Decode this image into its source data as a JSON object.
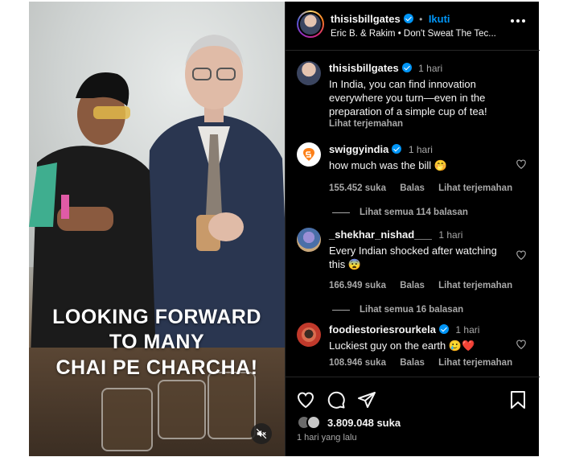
{
  "post": {
    "author": "thisisbillgates",
    "follow_label": "Ikuti",
    "separator": "•",
    "audio": "Eric B. & Rakim • Don't Sweat The Tec...",
    "more_icon": "more-horizontal-icon"
  },
  "media": {
    "overlay_lines": [
      "LOOKING FORWARD",
      "TO MANY",
      "CHAI PE CHARCHA!"
    ],
    "mute_icon": "mute-icon"
  },
  "caption": {
    "author": "thisisbillgates",
    "time": "1 hari",
    "text": "In India, you can find innovation everywhere you turn—even in the preparation of a simple cup of tea!",
    "translate": "Lihat terjemahan"
  },
  "comments": [
    {
      "user": "swiggyindia",
      "verified": true,
      "time": "1 hari",
      "text": "how much was the bill 🤭",
      "likes": "155.452 suka",
      "reply": "Balas",
      "translate": "Lihat terjemahan",
      "view_replies": "Lihat semua 114 balasan"
    },
    {
      "user": "_shekhar_nishad___",
      "verified": false,
      "time": "1 hari",
      "text": "Every Indian shocked after watching this 😨",
      "likes": "166.949 suka",
      "reply": "Balas",
      "translate": "Lihat terjemahan",
      "view_replies": "Lihat semua 16 balasan"
    },
    {
      "user": "foodiestoriesrourkela",
      "verified": true,
      "time": "1 hari",
      "text": "Luckiest guy on the earth 🥲❤️",
      "likes": "108.946 suka",
      "reply": "Balas",
      "translate": "Lihat terjemahan"
    }
  ],
  "footer": {
    "likes": "3.809.048 suka",
    "time": "1 hari yang lalu"
  },
  "colors": {
    "background": "#000000",
    "accent": "#0095f6",
    "muted": "#a8a8a8",
    "swiggy": "#fc8019"
  }
}
